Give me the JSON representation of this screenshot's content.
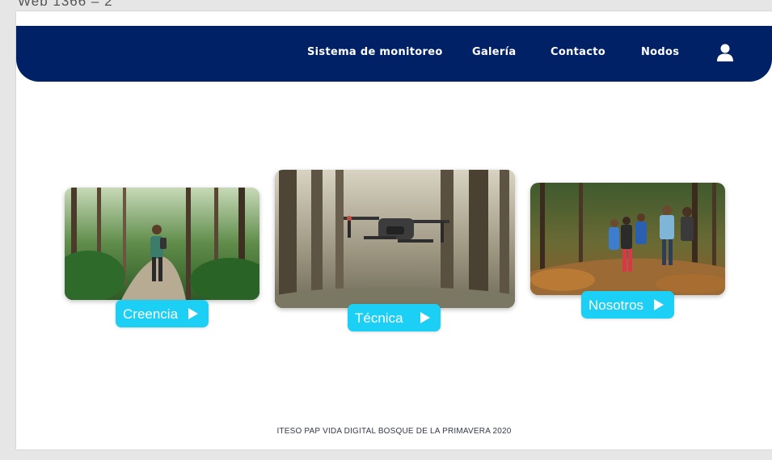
{
  "frame_label": "Web 1366 – 2",
  "nav": {
    "items": [
      {
        "label": "Sistema de monitoreo"
      },
      {
        "label": "Galería"
      },
      {
        "label": "Contacto"
      },
      {
        "label": "Nodos"
      }
    ],
    "user_icon": "user-icon"
  },
  "cards": [
    {
      "label": "Creencia",
      "image": "forest-hiker-photo"
    },
    {
      "label": "Técnica",
      "image": "drone-forest-photo"
    },
    {
      "label": "Nosotros",
      "image": "group-hikers-photo"
    }
  ],
  "footer": {
    "text": "ITESO PAP VIDA DIGITAL BOSQUE DE LA PRIMAVERA 2020"
  },
  "colors": {
    "navbar": "#002166",
    "button": "#1ccff4",
    "background": "#ffffff"
  }
}
